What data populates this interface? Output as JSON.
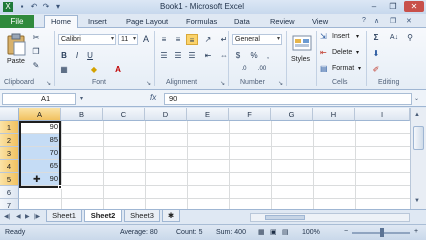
{
  "window": {
    "title": "Book1 - Microsoft Excel",
    "minimize": "–",
    "restore": "❐",
    "close": "✕"
  },
  "ribbon_tabs": [
    "File",
    "Home",
    "Insert",
    "Page Layout",
    "Formulas",
    "Data",
    "Review",
    "View"
  ],
  "ribbon_controls": {
    "help": "?",
    "min": "∧",
    "restore": "❐",
    "close": "✕"
  },
  "clipboard": {
    "paste_label": "Paste",
    "group_label": "Clipboard"
  },
  "font": {
    "name": "Calibri",
    "size": "11",
    "group_label": "Font",
    "bold": "B",
    "italic": "I",
    "underline": "U",
    "grow": "A",
    "shrink": "A"
  },
  "alignment": {
    "group_label": "Alignment"
  },
  "number": {
    "format": "General",
    "group_label": "Number",
    "currency": "$",
    "percent": "%",
    "comma": ",",
    "inc": ".0",
    "dec": ".00"
  },
  "styles": {
    "label": "Styles"
  },
  "cells": {
    "insert": "Insert",
    "delete": "Delete",
    "format": "Format",
    "group_label": "Cells"
  },
  "editing": {
    "group_label": "Editing",
    "sum": "Σ",
    "sort": "A↓",
    "find": "⚲"
  },
  "formula_bar": {
    "name_box": "A1",
    "fx": "fx",
    "value": "90"
  },
  "columns": [
    "A",
    "B",
    "C",
    "D",
    "E",
    "F",
    "G",
    "H",
    "I"
  ],
  "rows": [
    "1",
    "2",
    "3",
    "4",
    "5",
    "6",
    "7"
  ],
  "cells_data": [
    "90",
    "85",
    "70",
    "65",
    "90"
  ],
  "sheets": [
    "Sheet1",
    "Sheet2",
    "Sheet3"
  ],
  "status": {
    "ready": "Ready",
    "average": "Average: 80",
    "count": "Count: 5",
    "sum": "Sum: 400",
    "zoom": "100%",
    "zoom_out": "−",
    "zoom_in": "+"
  }
}
